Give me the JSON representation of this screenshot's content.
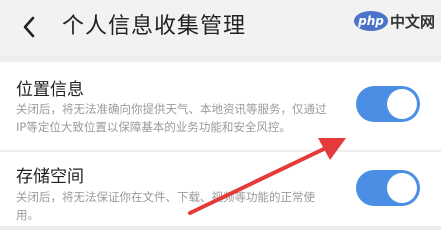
{
  "header": {
    "title": "个人信息收集管理",
    "back_icon": "chevron-left-icon"
  },
  "watermark": {
    "logo_text": "php",
    "site_text": "中文网"
  },
  "settings": [
    {
      "title": "位置信息",
      "description": "关闭后，将无法准确向你提供天气、本地资讯等服务，仅通过IP等定位大致位置以保障基本的业务功能和安全风控。",
      "enabled": true
    },
    {
      "title": "存储空间",
      "description": "关闭后，将无法保证你在文件、下载、视频等功能的正常使用。",
      "enabled": true
    }
  ],
  "colors": {
    "toggle_on": "#4a8fe3",
    "annotation_arrow": "#e53a3a"
  }
}
